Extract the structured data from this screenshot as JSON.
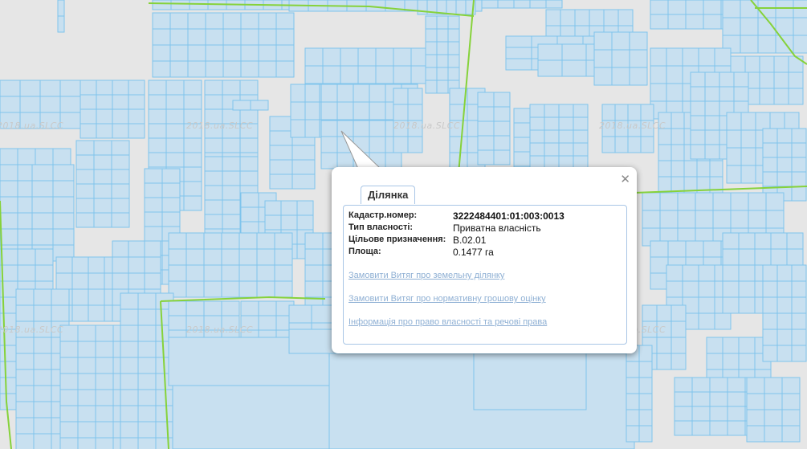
{
  "watermark": "2018.ua.SLCC",
  "colors": {
    "map_background": "#e6e6e6",
    "parcel_fill": "#c8e0f0",
    "parcel_stroke": "#7fc4ec",
    "boundary_line": "#86d23a"
  },
  "popup": {
    "tab_label": "Ділянка",
    "close_icon": "close-icon",
    "fields": [
      {
        "label": "Кадастр.номер:",
        "value": "3222484401:01:003:0013"
      },
      {
        "label": "Тип власності:",
        "value": "Приватна власність"
      },
      {
        "label": "Цільове призначення:",
        "value": "В.02.01"
      },
      {
        "label": "Площа:",
        "value": "0.1477 га"
      }
    ],
    "links": [
      "Замовити Витяг про земельну ділянку",
      "Замовити Витяг про нормативну грошову оцінку",
      "Інформація про право власності та речові права"
    ]
  }
}
